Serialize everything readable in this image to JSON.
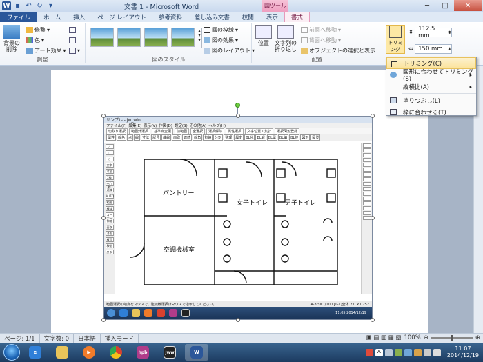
{
  "window": {
    "title": "文書 1 - Microsoft Word",
    "context_tab_group": "図ツール"
  },
  "tabs": [
    "ファイル",
    "ホーム",
    "挿入",
    "ページ レイアウト",
    "参考資料",
    "差し込み文書",
    "校閲",
    "表示",
    "書式"
  ],
  "ribbon": {
    "adjust": {
      "label": "調整",
      "remove_bg": "背景の削除",
      "corrections": "修整",
      "color": "色",
      "artistic": "アート効果"
    },
    "styles": {
      "label": "図のスタイル",
      "border": "図の枠線",
      "effects": "図の効果",
      "layout": "図のレイアウト"
    },
    "arrange": {
      "label": "配置",
      "position": "位置",
      "wrap_text": "文字列の折り返し",
      "bring_forward": "前面へ移動",
      "send_backward": "背面へ移動",
      "selection_pane": "オブジェクトの選択と表示"
    },
    "size": {
      "crop": "トリミング",
      "height": "112.5 mm",
      "width": "150 mm"
    }
  },
  "crop_menu": {
    "items": [
      {
        "label": "トリミング(C)"
      },
      {
        "label": "図形に合わせてトリミング(S)"
      },
      {
        "label": "縦横比(A)"
      },
      {
        "label": "塗りつぶし(L)"
      },
      {
        "label": "枠に合わせる(T)"
      }
    ]
  },
  "embedded": {
    "app_title": "サンプル - jw_win",
    "menu": [
      "ファイル(F)",
      "編集(E)",
      "表示(V)",
      "作図(D)",
      "設定(S)",
      "その他(A)",
      "ヘルプ(H)"
    ],
    "toolbar1": [
      "切取り選択",
      "範囲外選択",
      "基準点変更",
      "前範囲",
      "全選択",
      "選択解除",
      "属性選択",
      "文字位置・集計",
      "選択図形登録"
    ],
    "toolbar2": [
      "属性",
      "線色",
      "点",
      "線",
      "寸法",
      "記号",
      "曲線",
      "面取",
      "連続",
      "線角",
      "包絡",
      "分割",
      "整理",
      "属変",
      "BL化",
      "BL解",
      "BL属",
      "BL編",
      "BL終",
      "図形",
      "図登"
    ],
    "left_tools": [
      "／",
      "□",
      "○",
      "文字",
      "寸法",
      "2線",
      "中心線",
      "連線",
      "AUTO",
      "範囲",
      "複線",
      "コーナー",
      "伸縮",
      "面取",
      "消去",
      "複写",
      "移動",
      "戻る"
    ],
    "rooms": {
      "pantry": "パントリー",
      "women": "女子トイレ",
      "men": "男子トイレ",
      "mech": "空調機械室"
    },
    "status": "範囲選択の始点をマウスで、連続線選択はマウスで指示してください。",
    "status_right": "A-3  S=1/100  [0-1]全体  ∠0  ×1.252",
    "clock": "11:05\n2014/12/19"
  },
  "statusbar": {
    "page": "ページ: 1/1",
    "words": "文字数: 0",
    "lang": "日本語",
    "mode": "挿入モード",
    "zoom": "100%"
  },
  "taskbar": {
    "time": "11:07",
    "date": "2014/12/19",
    "apps": [
      "ie",
      "explorer",
      "media",
      "chrome",
      "hpb",
      "jww",
      "word"
    ]
  }
}
